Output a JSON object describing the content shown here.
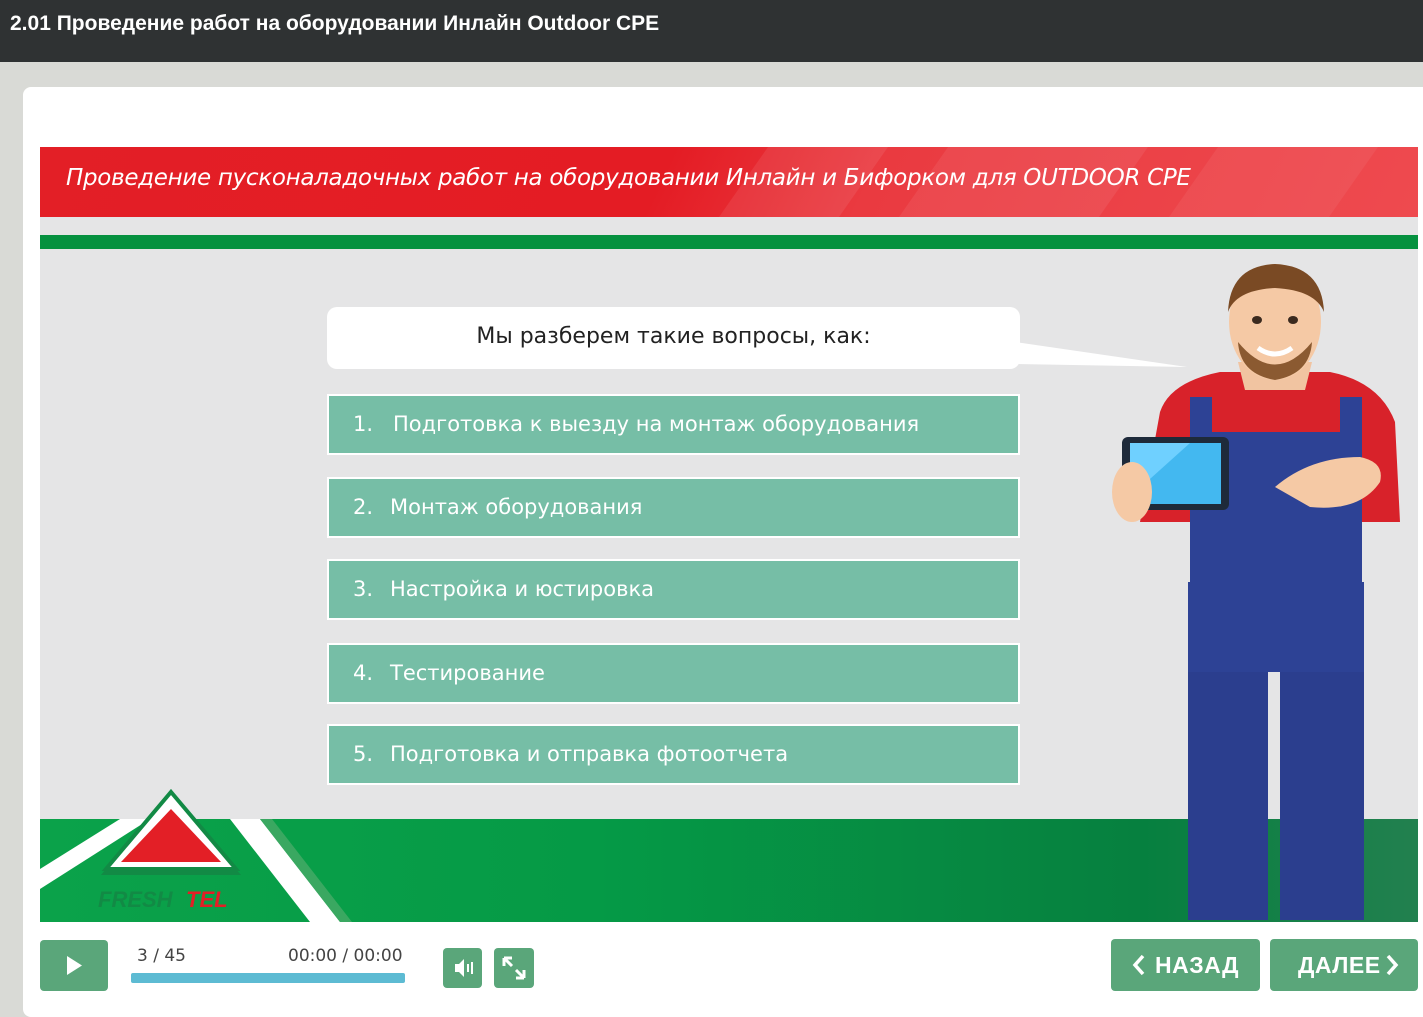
{
  "window": {
    "title": "2.01 Проведение работ на оборудовании Инлайн Outdoor CPE"
  },
  "slide": {
    "banner_title": "Проведение пусконаладочных работ на оборудовании Инлайн и Бифорком для OUTDOOR CPE",
    "bubble_text": "Мы разберем такие вопросы, как:",
    "items": [
      {
        "num": "1.",
        "label": "Подготовка к выезду на монтаж оборудования"
      },
      {
        "num": "2.",
        "label": "Монтаж оборудования"
      },
      {
        "num": "3.",
        "label": "Настройка и юстировка"
      },
      {
        "num": "4.",
        "label": "Тестирование"
      },
      {
        "num": "5.",
        "label": "Подготовка и отправка фотоотчета"
      }
    ],
    "logo_text_a": "FRESH",
    "logo_text_b": "TEL",
    "colors": {
      "banner_red": "#e41c24",
      "accent_green": "#05913f",
      "item_green": "#76bea6",
      "button_green": "#5aa67a"
    }
  },
  "player": {
    "counter": "3 / 45",
    "time": "00:00 / 00:00",
    "progress": 0,
    "back_label": "НАЗАД",
    "next_label": "ДАЛЕЕ",
    "icons": {
      "play": "play-icon",
      "volume": "volume-icon",
      "fullscreen": "fullscreen-icon",
      "back": "chevron-left-icon",
      "next": "chevron-right-icon"
    }
  }
}
